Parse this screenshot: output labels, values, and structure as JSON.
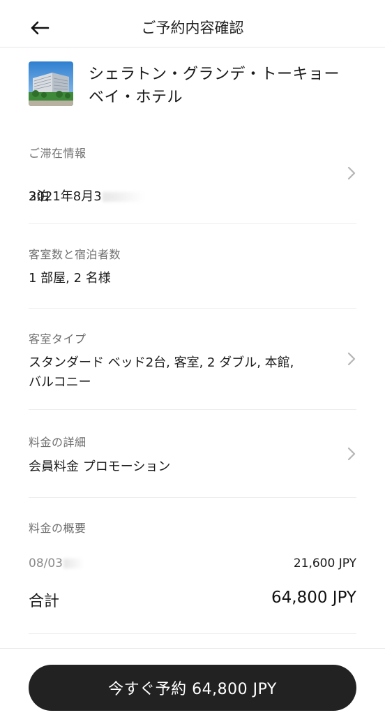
{
  "header": {
    "title": "ご予約内容確認",
    "back_icon": "arrow-left-icon"
  },
  "hotel": {
    "name": "シェラトン・グランデ・トーキョーベイ・ホテル",
    "thumbnail_icon": "hotel-thumbnail"
  },
  "stay": {
    "label": "ご滞在情報",
    "dates": "2021年8月3",
    "nights": "3泊"
  },
  "guests": {
    "label": "客室数と宿泊者数",
    "value": "1 部屋, 2 名様"
  },
  "room": {
    "label": "客室タイプ",
    "value": "スタンダード ベッド2台, 客室, 2 ダブル, 本館,\nバルコニー"
  },
  "rate": {
    "label": "料金の詳細",
    "value": "会員料金 プロモーション"
  },
  "summary": {
    "label": "料金の概要",
    "line_date": "08/03",
    "line_price": "21,600 JPY",
    "total_label": "合計",
    "total_price": "64,800 JPY"
  },
  "footer": {
    "book_label": "今すぐ予約 64,800 JPY"
  },
  "colors": {
    "primary": "#222222",
    "muted": "#6e6e6e",
    "divider": "#eeeeee"
  }
}
